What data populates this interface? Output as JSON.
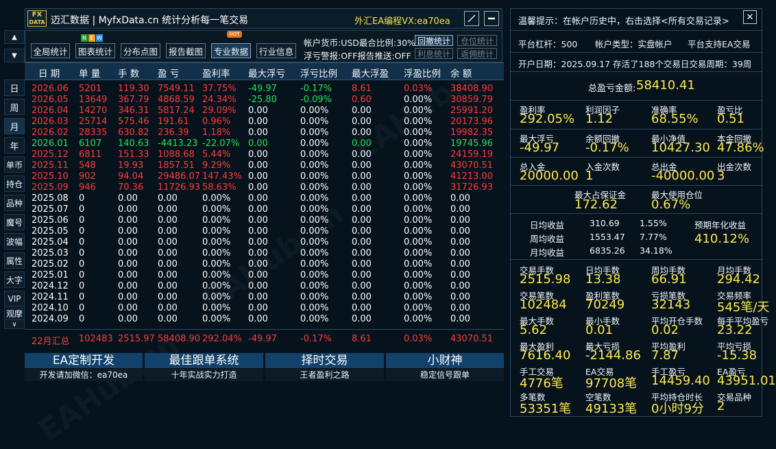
{
  "window": {
    "logo_top": "FX",
    "logo_bottom": "DATA",
    "title": "迈汇数据 | MyfxData.cn  统计分析每一笔交易",
    "wechat": "外汇EA编程VX:ea70ea"
  },
  "side_nav": {
    "up": "▲",
    "down": "▼",
    "items": [
      "日",
      "周",
      "月",
      "年",
      "单币",
      "持仓",
      "品种",
      "魔号",
      "波幅",
      "属性",
      "大字",
      "VIP",
      "观摩"
    ],
    "collapse": "∨",
    "active": "月"
  },
  "toolbar": {
    "buttons": [
      "全局统计",
      "图表统计",
      "分布点图",
      "报告截图",
      "专业数据",
      "行业信息"
    ],
    "new_badge": "NEW",
    "hot_badge": "HOT",
    "currency_info": "帐户货币:USD最合比例:30%",
    "alert_info": "浮亏警报:OFF报告推送:OFF",
    "btn_withdraw": "回撤统计",
    "btn_position": "仓位统计",
    "btn_interest": "利息统计",
    "btn_rebate": "返佣统计"
  },
  "table": {
    "headers": [
      "日 期",
      "单 量",
      "手 数",
      "盈 亏",
      "盈利率",
      "最大浮亏",
      "浮亏比例",
      "最大浮盈",
      "浮盈比例",
      "余 额"
    ],
    "rows": [
      {
        "c": "red",
        "v": [
          "2026.06",
          "5201",
          "119.30",
          "7549.11",
          "37.75%",
          "-49.97",
          "-0.17%",
          "8.61",
          "0.03%",
          "38408.90"
        ]
      },
      {
        "c": "red",
        "v": [
          "2026.05",
          "13649",
          "367.79",
          "4868.59",
          "24.34%",
          "-25.80",
          "-0.09%",
          "0.60",
          "0.00%",
          "30859.79"
        ]
      },
      {
        "c": "red",
        "v": [
          "2026.04",
          "14270",
          "346.31",
          "5817.24",
          "29.09%",
          "0.00",
          "0.00%",
          "0.00",
          "0.00%",
          "25991.20"
        ]
      },
      {
        "c": "red",
        "v": [
          "2026.03",
          "25714",
          "575.46",
          "191.61",
          "0.96%",
          "0.00",
          "0.00%",
          "0.00",
          "0.00%",
          "20173.96"
        ]
      },
      {
        "c": "red",
        "v": [
          "2026.02",
          "28335",
          "630.82",
          "236.39",
          "1.18%",
          "0.00",
          "0.00%",
          "0.00",
          "0.00%",
          "19982.35"
        ]
      },
      {
        "c": "green",
        "v": [
          "2026.01",
          "6107",
          "140.63",
          "-4413.23",
          "-22.07%",
          "0.00",
          "0.00%",
          "0.00",
          "0.00%",
          "19745.96"
        ]
      },
      {
        "c": "red",
        "v": [
          "2025.12",
          "6811",
          "151.33",
          "1088.68",
          "5.44%",
          "0.00",
          "0.00%",
          "0.00",
          "0.00%",
          "24159.19"
        ]
      },
      {
        "c": "red",
        "v": [
          "2025.11",
          "548",
          "19.93",
          "1857.51",
          "9.29%",
          "0.00",
          "0.00%",
          "0.00",
          "0.00%",
          "43070.51"
        ]
      },
      {
        "c": "red",
        "v": [
          "2025.10",
          "902",
          "94.04",
          "29486.07",
          "147.43%",
          "0.00",
          "0.00%",
          "0.00",
          "0.00%",
          "41213.00"
        ]
      },
      {
        "c": "red",
        "v": [
          "2025.09",
          "946",
          "70.36",
          "11726.93",
          "58.63%",
          "0.00",
          "0.00%",
          "0.00",
          "0.00%",
          "31726.93"
        ]
      },
      {
        "c": "white",
        "v": [
          "2025.08",
          "0",
          "0.00",
          "0.00",
          "0.00%",
          "0.00",
          "0.00%",
          "0.00",
          "0.00%",
          "0.00"
        ]
      },
      {
        "c": "white",
        "v": [
          "2025.07",
          "0",
          "0.00",
          "0.00",
          "0.00%",
          "0.00",
          "0.00%",
          "0.00",
          "0.00%",
          "0.00"
        ]
      },
      {
        "c": "white",
        "v": [
          "2025.06",
          "0",
          "0.00",
          "0.00",
          "0.00%",
          "0.00",
          "0.00%",
          "0.00",
          "0.00%",
          "0.00"
        ]
      },
      {
        "c": "white",
        "v": [
          "2025.05",
          "0",
          "0.00",
          "0.00",
          "0.00%",
          "0.00",
          "0.00%",
          "0.00",
          "0.00%",
          "0.00"
        ]
      },
      {
        "c": "white",
        "v": [
          "2025.04",
          "0",
          "0.00",
          "0.00",
          "0.00%",
          "0.00",
          "0.00%",
          "0.00",
          "0.00%",
          "0.00"
        ]
      },
      {
        "c": "white",
        "v": [
          "2025.03",
          "0",
          "0.00",
          "0.00",
          "0.00%",
          "0.00",
          "0.00%",
          "0.00",
          "0.00%",
          "0.00"
        ]
      },
      {
        "c": "white",
        "v": [
          "2025.02",
          "0",
          "0.00",
          "0.00",
          "0.00%",
          "0.00",
          "0.00%",
          "0.00",
          "0.00%",
          "0.00"
        ]
      },
      {
        "c": "white",
        "v": [
          "2025.01",
          "0",
          "0.00",
          "0.00",
          "0.00%",
          "0.00",
          "0.00%",
          "0.00",
          "0.00%",
          "0.00"
        ]
      },
      {
        "c": "white",
        "v": [
          "2024.12",
          "0",
          "0.00",
          "0.00",
          "0.00%",
          "0.00",
          "0.00%",
          "0.00",
          "0.00%",
          "0.00"
        ]
      },
      {
        "c": "white",
        "v": [
          "2024.11",
          "0",
          "0.00",
          "0.00",
          "0.00%",
          "0.00",
          "0.00%",
          "0.00",
          "0.00%",
          "0.00"
        ]
      },
      {
        "c": "white",
        "v": [
          "2024.10",
          "0",
          "0.00",
          "0.00",
          "0.00%",
          "0.00",
          "0.00%",
          "0.00",
          "0.00%",
          "0.00"
        ]
      },
      {
        "c": "white",
        "v": [
          "2024.09",
          "0",
          "0.00",
          "0.00",
          "0.00%",
          "0.00",
          "0.00%",
          "0.00",
          "0.00%",
          "0.00"
        ]
      }
    ],
    "summary": [
      "22月汇总",
      "102483",
      "2515.97",
      "58408.90",
      "292.04%",
      "-49.97",
      "-0.17%",
      "8.61",
      "0.03%",
      "43070.51"
    ]
  },
  "banners": [
    {
      "title": "EA定制开发",
      "sub": "开发请加微信：ea70ea"
    },
    {
      "title": "最佳跟单系统",
      "sub": "十年实战实力打造"
    },
    {
      "title": "择时交易",
      "sub": "王者盈利之路"
    },
    {
      "title": "小财神",
      "sub": "稳定信号跟单"
    }
  ],
  "right": {
    "tip": "温馨提示：在帐户历史中，右击选择<所有交易记录>",
    "leverage": "平台杠杆：500",
    "account_type": "帐户类型：实盘帐户",
    "ea_support": "平台支持EA交易",
    "open_info": "开户日期：2025.09.17 存活了188个交易日交易周期：39周",
    "total_label": "总盈亏金额:",
    "total_value": "58410.41",
    "stats1": [
      {
        "l": "盈利率",
        "v": "292.05%"
      },
      {
        "l": "利润因子",
        "v": "1.12"
      },
      {
        "l": "准确率",
        "v": "68.55%"
      },
      {
        "l": "盈亏比",
        "v": "0.51"
      },
      {
        "l": "最大浮亏",
        "v": "-49.97"
      },
      {
        "l": "余额回撤",
        "v": "-0.17%"
      },
      {
        "l": "最小净值",
        "v": "10427.30"
      },
      {
        "l": "本金回撤",
        "v": "47.86%"
      },
      {
        "l": "总入金",
        "v": "20000.00"
      },
      {
        "l": "入金次数",
        "v": "1"
      },
      {
        "l": "总出金",
        "v": "-40000.00"
      },
      {
        "l": "出金次数",
        "v": "3"
      }
    ],
    "margin_label": "最大占保证金",
    "margin_value": "172.62",
    "pos_label": "最大使用仓位",
    "pos_value": "0.67%",
    "returns": [
      {
        "l": "日均收益",
        "a": "310.69",
        "p": "1.55%"
      },
      {
        "l": "周均收益",
        "a": "1553.47",
        "p": "7.77%"
      },
      {
        "l": "月均收益",
        "a": "6835.26",
        "p": "34.18%"
      }
    ],
    "annual_label": "预期年化收益",
    "annual_value": "410.12%",
    "stats2": [
      {
        "l": "交易手数",
        "v": "2515.98"
      },
      {
        "l": "日均手数",
        "v": "13.38"
      },
      {
        "l": "周均手数",
        "v": "66.91"
      },
      {
        "l": "月均手数",
        "v": "294.42"
      },
      {
        "l": "交易笔数",
        "v": "102484"
      },
      {
        "l": "盈利笔数",
        "v": "70249"
      },
      {
        "l": "亏损笔数",
        "v": "32143"
      },
      {
        "l": "交易频率",
        "v": "545笔/天"
      },
      {
        "l": "最大手数",
        "v": "5.62"
      },
      {
        "l": "最小手数",
        "v": "0.01"
      },
      {
        "l": "平均开仓手数",
        "v": "0.02"
      },
      {
        "l": "每手平均盈亏",
        "v": "23.22"
      },
      {
        "l": "最大盈利",
        "v": "7616.40"
      },
      {
        "l": "最大亏损",
        "v": "-2144.86"
      },
      {
        "l": "平均盈利",
        "v": "7.87"
      },
      {
        "l": "平均亏损",
        "v": "-15.38"
      },
      {
        "l": "手工交易",
        "v": "4776笔"
      },
      {
        "l": "EA交易",
        "v": "97708笔"
      },
      {
        "l": "手工盈亏",
        "v": "14459.40"
      },
      {
        "l": "EA盈亏",
        "v": "43951.01"
      },
      {
        "l": "多笔数",
        "v": "53351笔"
      },
      {
        "l": "空笔数",
        "v": "49133笔"
      },
      {
        "l": "平均持仓时长",
        "v": "0小时9分"
      },
      {
        "l": "交易品种",
        "v": "2"
      }
    ],
    "close": "✕"
  },
  "watermark": "EAHub.cn"
}
